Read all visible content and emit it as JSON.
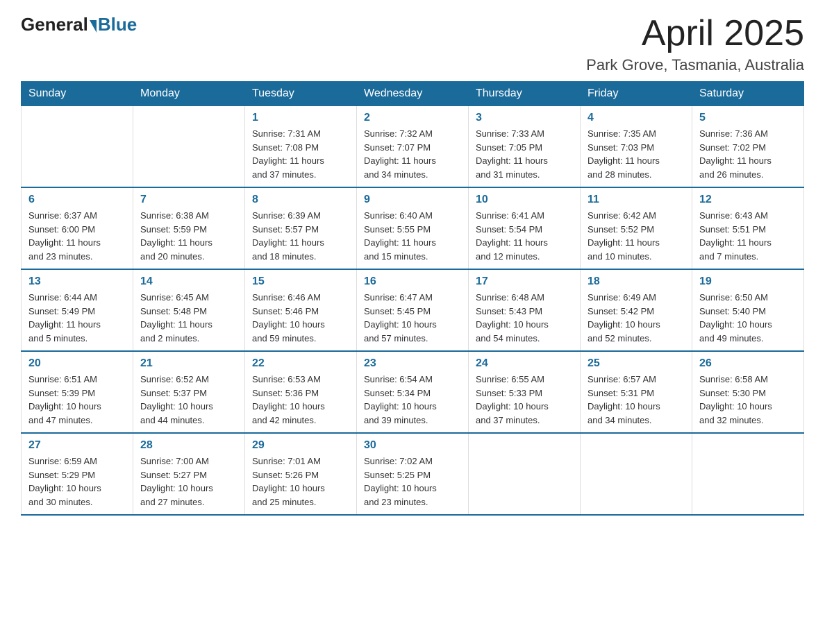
{
  "header": {
    "logo_general": "General",
    "logo_blue": "Blue",
    "month_title": "April 2025",
    "location": "Park Grove, Tasmania, Australia"
  },
  "weekdays": [
    "Sunday",
    "Monday",
    "Tuesday",
    "Wednesday",
    "Thursday",
    "Friday",
    "Saturday"
  ],
  "weeks": [
    [
      {
        "day": "",
        "info": ""
      },
      {
        "day": "",
        "info": ""
      },
      {
        "day": "1",
        "info": "Sunrise: 7:31 AM\nSunset: 7:08 PM\nDaylight: 11 hours\nand 37 minutes."
      },
      {
        "day": "2",
        "info": "Sunrise: 7:32 AM\nSunset: 7:07 PM\nDaylight: 11 hours\nand 34 minutes."
      },
      {
        "day": "3",
        "info": "Sunrise: 7:33 AM\nSunset: 7:05 PM\nDaylight: 11 hours\nand 31 minutes."
      },
      {
        "day": "4",
        "info": "Sunrise: 7:35 AM\nSunset: 7:03 PM\nDaylight: 11 hours\nand 28 minutes."
      },
      {
        "day": "5",
        "info": "Sunrise: 7:36 AM\nSunset: 7:02 PM\nDaylight: 11 hours\nand 26 minutes."
      }
    ],
    [
      {
        "day": "6",
        "info": "Sunrise: 6:37 AM\nSunset: 6:00 PM\nDaylight: 11 hours\nand 23 minutes."
      },
      {
        "day": "7",
        "info": "Sunrise: 6:38 AM\nSunset: 5:59 PM\nDaylight: 11 hours\nand 20 minutes."
      },
      {
        "day": "8",
        "info": "Sunrise: 6:39 AM\nSunset: 5:57 PM\nDaylight: 11 hours\nand 18 minutes."
      },
      {
        "day": "9",
        "info": "Sunrise: 6:40 AM\nSunset: 5:55 PM\nDaylight: 11 hours\nand 15 minutes."
      },
      {
        "day": "10",
        "info": "Sunrise: 6:41 AM\nSunset: 5:54 PM\nDaylight: 11 hours\nand 12 minutes."
      },
      {
        "day": "11",
        "info": "Sunrise: 6:42 AM\nSunset: 5:52 PM\nDaylight: 11 hours\nand 10 minutes."
      },
      {
        "day": "12",
        "info": "Sunrise: 6:43 AM\nSunset: 5:51 PM\nDaylight: 11 hours\nand 7 minutes."
      }
    ],
    [
      {
        "day": "13",
        "info": "Sunrise: 6:44 AM\nSunset: 5:49 PM\nDaylight: 11 hours\nand 5 minutes."
      },
      {
        "day": "14",
        "info": "Sunrise: 6:45 AM\nSunset: 5:48 PM\nDaylight: 11 hours\nand 2 minutes."
      },
      {
        "day": "15",
        "info": "Sunrise: 6:46 AM\nSunset: 5:46 PM\nDaylight: 10 hours\nand 59 minutes."
      },
      {
        "day": "16",
        "info": "Sunrise: 6:47 AM\nSunset: 5:45 PM\nDaylight: 10 hours\nand 57 minutes."
      },
      {
        "day": "17",
        "info": "Sunrise: 6:48 AM\nSunset: 5:43 PM\nDaylight: 10 hours\nand 54 minutes."
      },
      {
        "day": "18",
        "info": "Sunrise: 6:49 AM\nSunset: 5:42 PM\nDaylight: 10 hours\nand 52 minutes."
      },
      {
        "day": "19",
        "info": "Sunrise: 6:50 AM\nSunset: 5:40 PM\nDaylight: 10 hours\nand 49 minutes."
      }
    ],
    [
      {
        "day": "20",
        "info": "Sunrise: 6:51 AM\nSunset: 5:39 PM\nDaylight: 10 hours\nand 47 minutes."
      },
      {
        "day": "21",
        "info": "Sunrise: 6:52 AM\nSunset: 5:37 PM\nDaylight: 10 hours\nand 44 minutes."
      },
      {
        "day": "22",
        "info": "Sunrise: 6:53 AM\nSunset: 5:36 PM\nDaylight: 10 hours\nand 42 minutes."
      },
      {
        "day": "23",
        "info": "Sunrise: 6:54 AM\nSunset: 5:34 PM\nDaylight: 10 hours\nand 39 minutes."
      },
      {
        "day": "24",
        "info": "Sunrise: 6:55 AM\nSunset: 5:33 PM\nDaylight: 10 hours\nand 37 minutes."
      },
      {
        "day": "25",
        "info": "Sunrise: 6:57 AM\nSunset: 5:31 PM\nDaylight: 10 hours\nand 34 minutes."
      },
      {
        "day": "26",
        "info": "Sunrise: 6:58 AM\nSunset: 5:30 PM\nDaylight: 10 hours\nand 32 minutes."
      }
    ],
    [
      {
        "day": "27",
        "info": "Sunrise: 6:59 AM\nSunset: 5:29 PM\nDaylight: 10 hours\nand 30 minutes."
      },
      {
        "day": "28",
        "info": "Sunrise: 7:00 AM\nSunset: 5:27 PM\nDaylight: 10 hours\nand 27 minutes."
      },
      {
        "day": "29",
        "info": "Sunrise: 7:01 AM\nSunset: 5:26 PM\nDaylight: 10 hours\nand 25 minutes."
      },
      {
        "day": "30",
        "info": "Sunrise: 7:02 AM\nSunset: 5:25 PM\nDaylight: 10 hours\nand 23 minutes."
      },
      {
        "day": "",
        "info": ""
      },
      {
        "day": "",
        "info": ""
      },
      {
        "day": "",
        "info": ""
      }
    ]
  ]
}
